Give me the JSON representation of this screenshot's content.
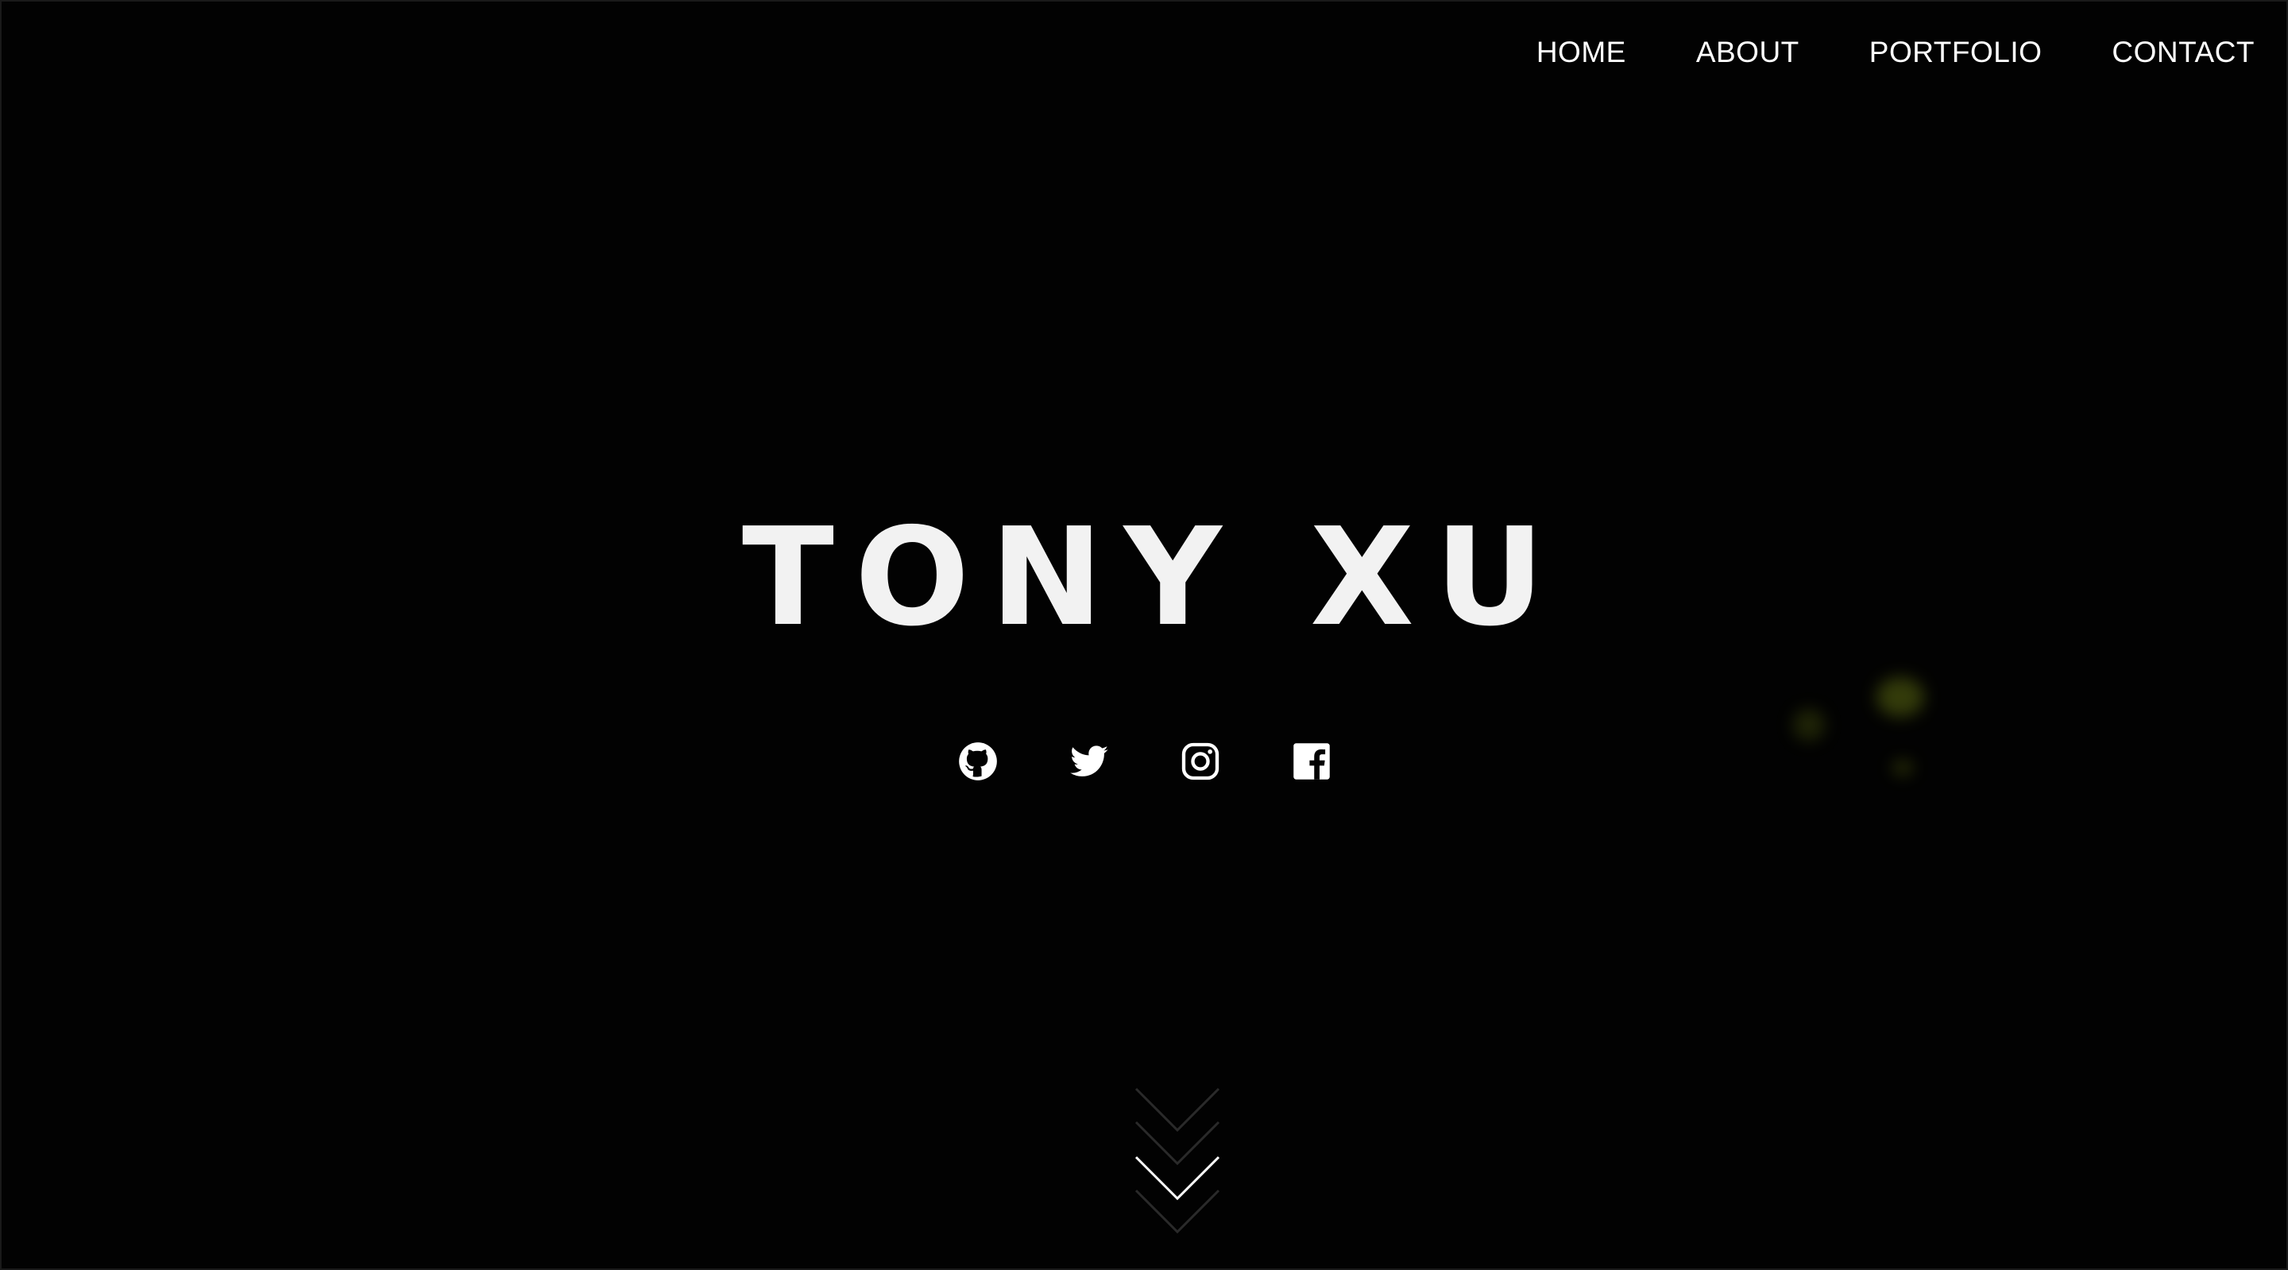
{
  "nav": {
    "items": [
      {
        "label": "HOME"
      },
      {
        "label": "ABOUT"
      },
      {
        "label": "PORTFOLIO"
      },
      {
        "label": "CONTACT"
      }
    ]
  },
  "hero": {
    "title": "TONY XU"
  },
  "social": {
    "icons": [
      "github-icon",
      "twitter-icon",
      "instagram-icon",
      "facebook-icon"
    ]
  },
  "scroll_cue": {
    "icon": "chevron-down-icon"
  },
  "colors": {
    "background": "#020202",
    "text": "#ffffff",
    "accent_glow": "#5c6a12"
  }
}
